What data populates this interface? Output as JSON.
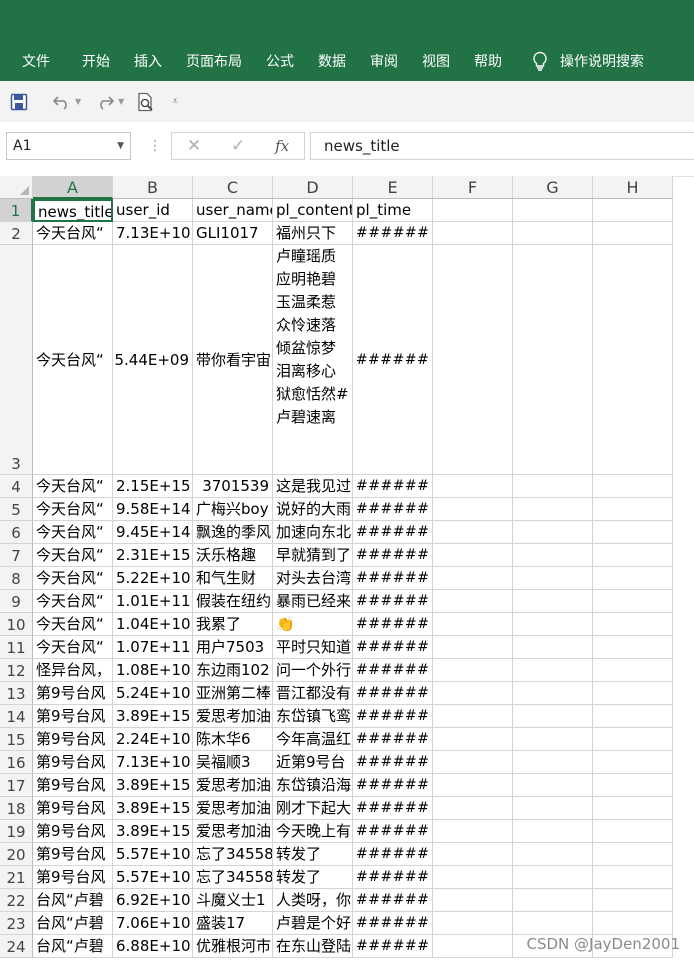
{
  "menu": {
    "tabs": [
      "文件",
      "开始",
      "插入",
      "页面布局",
      "公式",
      "数据",
      "审阅",
      "视图",
      "帮助"
    ],
    "tell_me": "操作说明搜索",
    "icon": "lightbulb-icon"
  },
  "quick_access": {
    "icons": [
      "save-icon",
      "undo-icon",
      "redo-icon",
      "print-preview-icon",
      "customize-icon"
    ]
  },
  "formula_bar": {
    "name_box": "A1",
    "cancel_icon": "✕",
    "enter_icon": "✓",
    "fx_label": "fx",
    "content": "news_title"
  },
  "columns": [
    "A",
    "B",
    "C",
    "D",
    "E",
    "F",
    "G",
    "H"
  ],
  "rows": [
    {
      "n": "1",
      "cells": [
        "news_title",
        "user_id",
        "user_name",
        "pl_content",
        "pl_time"
      ]
    },
    {
      "n": "2",
      "cells": [
        "今天台风“",
        "7.13E+10",
        "GLI1017",
        "福州只下",
        "######"
      ]
    },
    {
      "n": "3",
      "cells": [
        "今天台风“",
        "5.44E+09",
        "带你看宇宙",
        "卢瞳瑶质应明艳碧玉温柔惹众怜速落倾盆惊梦泪离移心狱愈恬然#卢碧速离",
        "######"
      ]
    },
    {
      "n": "4",
      "cells": [
        "今天台风“",
        "2.15E+15",
        "3701539",
        "这是我见过",
        "######"
      ]
    },
    {
      "n": "5",
      "cells": [
        "今天台风“",
        "9.58E+14",
        "广梅兴boy",
        "说好的大雨",
        "######"
      ]
    },
    {
      "n": "6",
      "cells": [
        "今天台风“",
        "9.45E+14",
        "飘逸的季风",
        "加速向东北",
        "######"
      ]
    },
    {
      "n": "7",
      "cells": [
        "今天台风“",
        "2.31E+15",
        "沃乐格趣",
        "早就猜到了",
        "######"
      ]
    },
    {
      "n": "8",
      "cells": [
        "今天台风“",
        "5.22E+10",
        "和气生财",
        "对头去台湾",
        "######"
      ]
    },
    {
      "n": "9",
      "cells": [
        "今天台风“",
        "1.01E+11",
        "假装在纽约",
        "暴雨已经来",
        "######"
      ]
    },
    {
      "n": "10",
      "cells": [
        "今天台风“",
        "1.04E+10",
        "我累了",
        "👏",
        "######"
      ]
    },
    {
      "n": "11",
      "cells": [
        "今天台风“",
        "1.07E+11",
        "用户7503",
        "平时只知道",
        "######"
      ]
    },
    {
      "n": "12",
      "cells": [
        "怪异台风，",
        "1.08E+10",
        "东边雨102",
        "问一个外行",
        "######"
      ]
    },
    {
      "n": "13",
      "cells": [
        "第9号台风",
        "5.24E+10",
        "亚洲第二棒",
        "晋江都没有",
        "######"
      ]
    },
    {
      "n": "14",
      "cells": [
        "第9号台风",
        "3.89E+15",
        "爱思考加油",
        "东岱镇飞鸾",
        "######"
      ]
    },
    {
      "n": "15",
      "cells": [
        "第9号台风",
        "2.24E+10",
        "陈木华6",
        "今年高温红",
        "######"
      ]
    },
    {
      "n": "16",
      "cells": [
        "第9号台风",
        "7.13E+10",
        "吴福顺3",
        "近第9号台",
        "######"
      ]
    },
    {
      "n": "17",
      "cells": [
        "第9号台风",
        "3.89E+15",
        "爱思考加油",
        "东岱镇沿海",
        "######"
      ]
    },
    {
      "n": "18",
      "cells": [
        "第9号台风",
        "3.89E+15",
        "爱思考加油",
        "刚才下起大",
        "######"
      ]
    },
    {
      "n": "19",
      "cells": [
        "第9号台风",
        "3.89E+15",
        "爱思考加油",
        "今天晚上有",
        "######"
      ]
    },
    {
      "n": "20",
      "cells": [
        "第9号台风",
        "5.57E+10",
        "忘了34558",
        "转发了",
        "######"
      ]
    },
    {
      "n": "21",
      "cells": [
        "第9号台风",
        "5.57E+10",
        "忘了34558",
        "转发了",
        "######"
      ]
    },
    {
      "n": "22",
      "cells": [
        "台风“卢碧",
        "6.92E+10",
        "斗魔义士1",
        "人类呀，你",
        "######"
      ]
    },
    {
      "n": "23",
      "cells": [
        "台风“卢碧",
        "7.06E+10",
        "盛装17",
        "卢碧是个好",
        "######"
      ]
    },
    {
      "n": "24",
      "cells": [
        "台风“卢碧",
        "6.88E+10",
        "优雅根河市",
        "在东山登陆",
        "######"
      ]
    }
  ],
  "watermark": "CSDN @JayDen2001"
}
